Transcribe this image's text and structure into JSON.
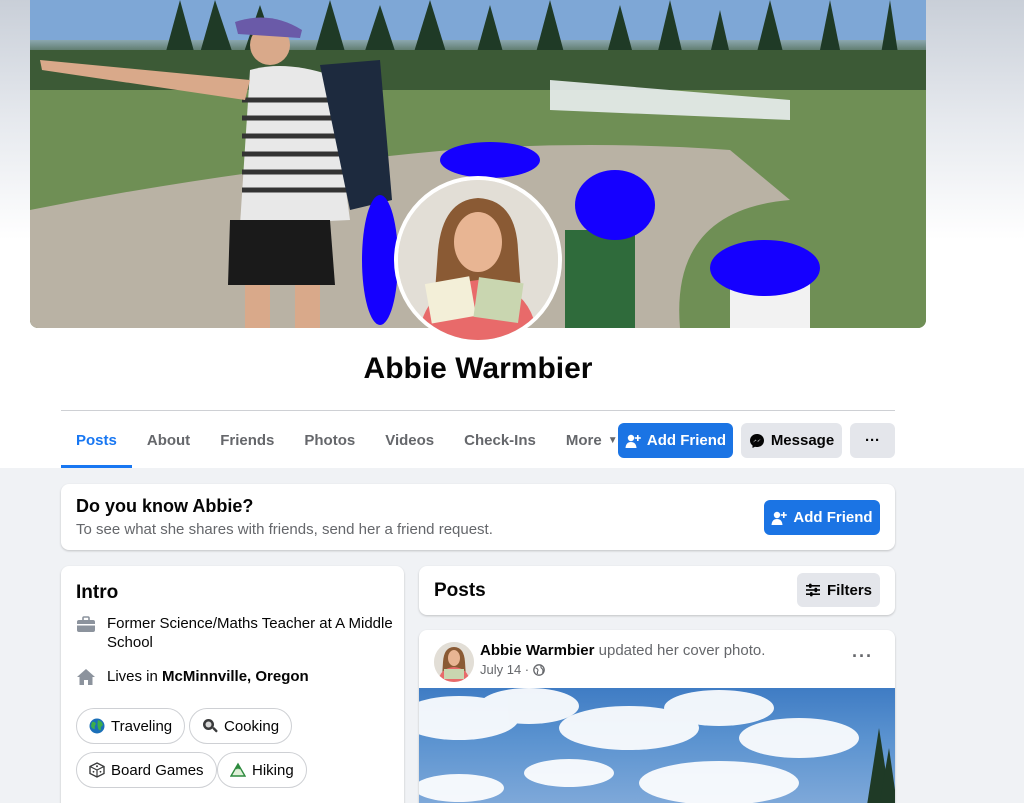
{
  "profile": {
    "name": "Abbie Warmbier"
  },
  "tabs": [
    {
      "label": "Posts",
      "active": true
    },
    {
      "label": "About"
    },
    {
      "label": "Friends"
    },
    {
      "label": "Photos"
    },
    {
      "label": "Videos"
    },
    {
      "label": "Check-Ins"
    },
    {
      "label": "More"
    }
  ],
  "actions": {
    "add_friend": "Add Friend",
    "message": "Message",
    "more": "···"
  },
  "know_card": {
    "title": "Do you know Abbie?",
    "subtitle": "To see what she shares with friends, send her a friend request.",
    "button": "Add Friend"
  },
  "intro": {
    "title": "Intro",
    "work_line1": "Former Science/Maths Teacher at A Middle",
    "work_line2": "School",
    "lives_prefix": "Lives in ",
    "lives_city": "McMinnville, Oregon",
    "hobbies": [
      "Traveling",
      "Cooking",
      "Board Games",
      "Hiking"
    ]
  },
  "posts_header": {
    "title": "Posts",
    "filters": "Filters"
  },
  "post": {
    "author": "Abbie Warmbier",
    "action": " updated her cover photo.",
    "date": "July 14 ·",
    "menu": "···"
  },
  "colors": {
    "accent": "#1b74e4",
    "active_tab": "#1877f2",
    "secondary_text": "#65676b"
  }
}
